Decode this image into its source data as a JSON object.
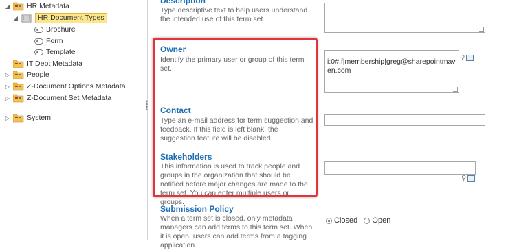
{
  "tree": {
    "items": [
      {
        "label": "HR Metadata"
      },
      {
        "label": "HR Document Types"
      },
      {
        "label": "Brochure"
      },
      {
        "label": "Form"
      },
      {
        "label": "Template"
      },
      {
        "label": "IT Dept Metadata"
      },
      {
        "label": "People"
      },
      {
        "label": "Z-Document Options Metadata"
      },
      {
        "label": "Z-Document Set Metadata"
      },
      {
        "label": "System"
      }
    ]
  },
  "form": {
    "description": {
      "title": "Description",
      "help": "Type descriptive text to help users understand the intended use of this term set."
    },
    "owner": {
      "title": "Owner",
      "help": "Identify the primary user or group of this term set.",
      "value": "i:0#.f|membership|greg@sharepointmaven.com"
    },
    "contact": {
      "title": "Contact",
      "help": "Type an e-mail address for term suggestion and feedback. If this field is left blank, the suggestion feature will be disabled.",
      "value": ""
    },
    "stakeholders": {
      "title": "Stakeholders",
      "help": "This information is used to track people and groups in the organization that should be notified before major changes are made to the term set. You can enter multiple users or groups.",
      "value": ""
    },
    "submission_policy": {
      "title": "Submission Policy",
      "help": "When a term set is closed, only metadata managers can add terms to this term set. When it is open, users can add terms from a tagging application.",
      "options": [
        "Closed",
        "Open"
      ],
      "selected": "Closed"
    }
  },
  "colors": {
    "highlight": "#e5333a",
    "section_title": "#1f6fb5",
    "selected_bg": "#fce68a"
  }
}
